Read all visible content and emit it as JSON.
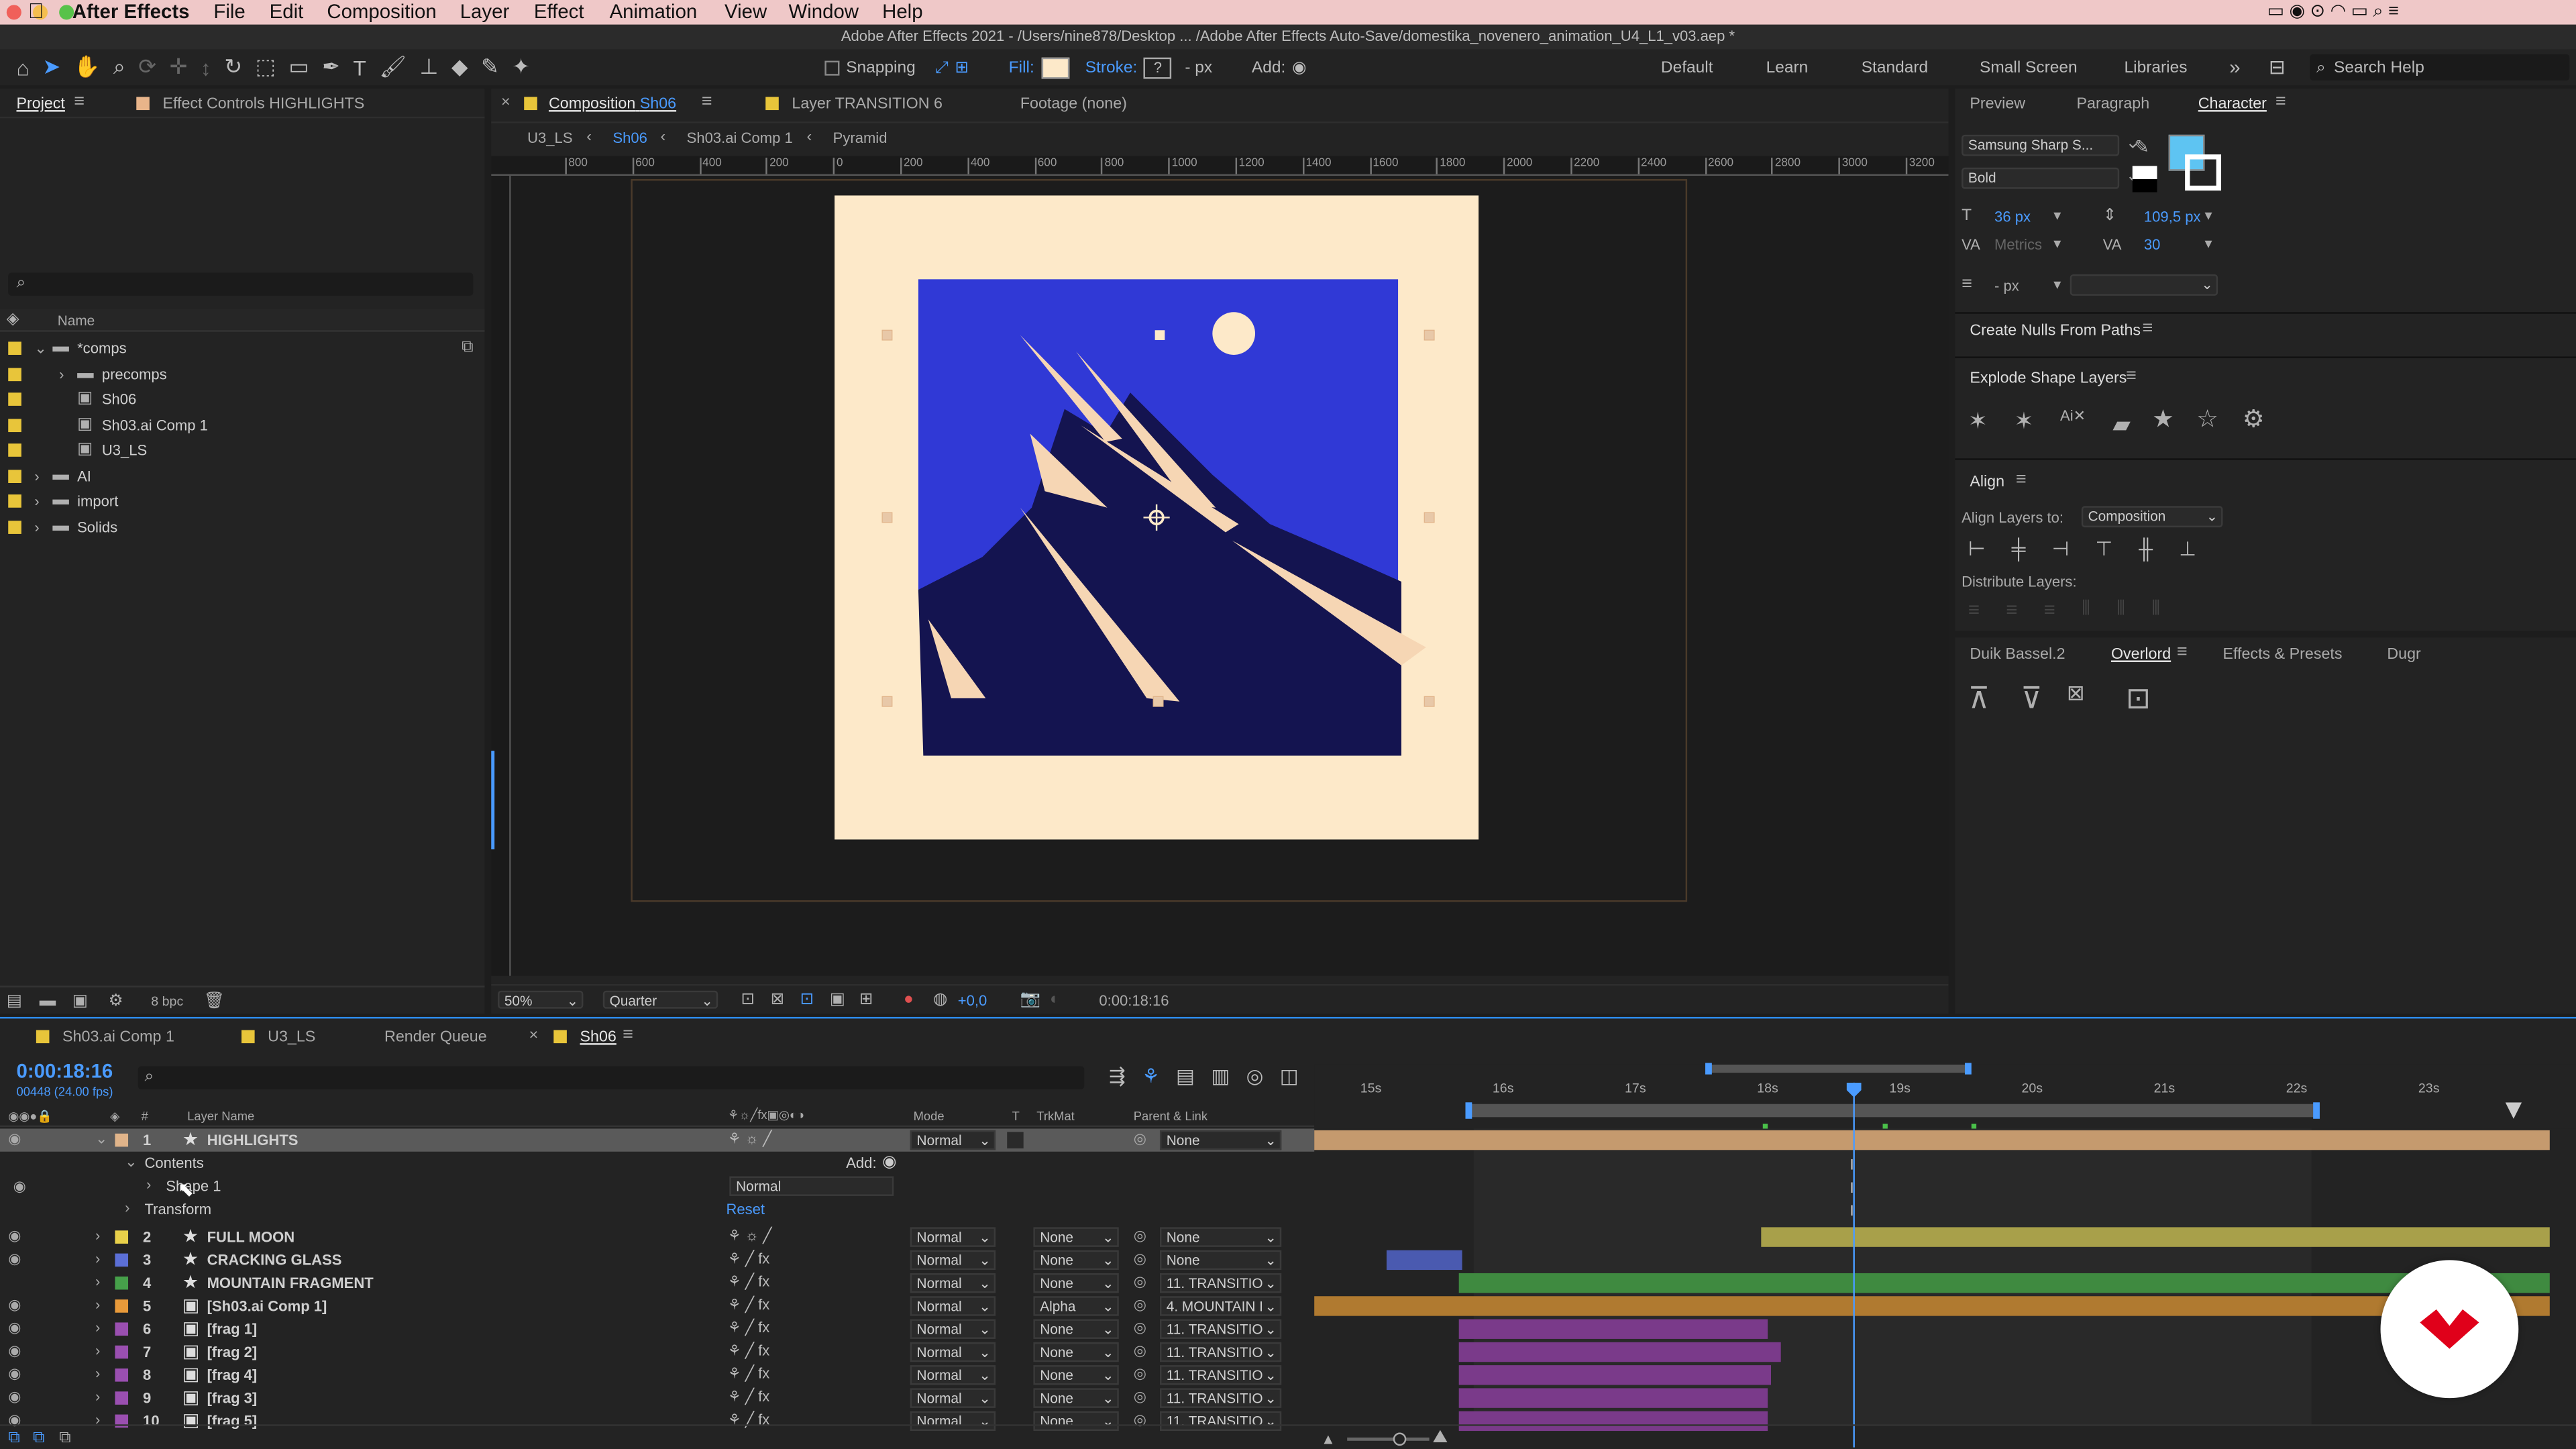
{
  "menubar": {
    "app": "After Effects",
    "items": [
      "File",
      "Edit",
      "Composition",
      "Layer",
      "Effect",
      "Animation",
      "View",
      "Window",
      "Help"
    ],
    "bg": "#efc8c8"
  },
  "title": "Adobe After Effects 2021 - /Users/nine878/Desktop ... /Adobe After Effects Auto-Save/domestika_novenero_animation_U4_L1_v03.aep *",
  "toolbar": {
    "snapping": "Snapping",
    "fill": "Fill:",
    "stroke": "Stroke:",
    "stroke_val": "?",
    "px": "- px",
    "add": "Add:",
    "workspaces": [
      "Default",
      "Learn",
      "Standard",
      "Small Screen",
      "Libraries"
    ],
    "search": "Search Help"
  },
  "project": {
    "tab": "Project",
    "effect_tab": "Effect Controls HIGHLIGHTS",
    "col_name": "Name",
    "items": [
      {
        "name": "*comps",
        "color": "#e8c53a",
        "indent": 0,
        "type": "folder",
        "open": true
      },
      {
        "name": "precomps",
        "color": "#e8c53a",
        "indent": 1,
        "type": "folder",
        "open": false
      },
      {
        "name": "Sh06",
        "color": "#e8c53a",
        "indent": 1,
        "type": "comp"
      },
      {
        "name": "Sh03.ai Comp 1",
        "color": "#e8c53a",
        "indent": 1,
        "type": "comp"
      },
      {
        "name": "U3_LS",
        "color": "#e8c53a",
        "indent": 1,
        "type": "comp"
      },
      {
        "name": "AI",
        "color": "#e8c53a",
        "indent": 0,
        "type": "folder",
        "open": false
      },
      {
        "name": "import",
        "color": "#e8c53a",
        "indent": 0,
        "type": "folder",
        "open": false
      },
      {
        "name": "Solids",
        "color": "#e8c53a",
        "indent": 0,
        "type": "folder",
        "open": false
      }
    ],
    "bpc": "8 bpc"
  },
  "viewer": {
    "tab_prefix": "Composition",
    "tab_name": "Sh06",
    "layer_tab": "Layer TRANSITION 6",
    "footage_tab": "Footage (none)",
    "breadcrumbs": [
      "U3_LS",
      "Sh06",
      "Sh03.ai Comp 1",
      "Pyramid"
    ],
    "ruler": [
      "800",
      "600",
      "400",
      "200",
      "0",
      "200",
      "400",
      "600",
      "800",
      "1000",
      "1200",
      "1400",
      "1600",
      "1800",
      "2000",
      "2200",
      "2400",
      "2600",
      "2800",
      "3000",
      "3200"
    ],
    "zoom": "50%",
    "quality": "Quarter",
    "exposure": "+0,0",
    "time": "0:00:18:16"
  },
  "right": {
    "tabs": [
      "Preview",
      "Paragraph",
      "Character"
    ],
    "font": "Samsung Sharp S...",
    "style": "Bold",
    "size": "36 px",
    "leading": "109,5 px",
    "kerning": "Metrics",
    "tracking": "30",
    "stroke_w": "- px",
    "nulls": "Create Nulls From Paths",
    "explode": "Explode Shape Layers",
    "align": "Align",
    "align_to_label": "Align Layers to:",
    "align_to": "Composition",
    "distribute": "Distribute Layers:",
    "tabs2": [
      "Duik Bassel.2",
      "Overlord",
      "Effects & Presets",
      "Dugr"
    ],
    "fill_color": "#5ec4f2"
  },
  "timeline": {
    "tabs": [
      "Sh03.ai Comp 1",
      "U3_LS",
      "Render Queue",
      "Sh06"
    ],
    "time": "0:00:18:16",
    "frames": "00448 (24.00 fps)",
    "headers": {
      "layer": "Layer Name",
      "mode": "Mode",
      "t": "T",
      "trk": "TrkMat",
      "parent": "Parent & Link"
    },
    "ruler": [
      "15s",
      "16s",
      "17s",
      "18s",
      "19s",
      "20s",
      "21s",
      "22s",
      "23s"
    ],
    "contents": "Contents",
    "add": "Add:",
    "shape1": "Shape 1",
    "shape_mode": "Normal",
    "transform": "Transform",
    "reset": "Reset",
    "layers": [
      {
        "n": "1",
        "name": "HIGHLIGHTS",
        "color": "#e0b48a",
        "mode": "Normal",
        "trk": "",
        "parent": "None",
        "bracket": false
      },
      {
        "n": "2",
        "name": "FULL MOON",
        "color": "#e8d04a",
        "mode": "Normal",
        "trk": "None",
        "parent": "None",
        "bracket": false
      },
      {
        "n": "3",
        "name": "CRACKING GLASS",
        "color": "#5b6fd6",
        "mode": "Normal",
        "trk": "None",
        "parent": "None",
        "bracket": false
      },
      {
        "n": "4",
        "name": "MOUNTAIN FRAGMENT",
        "color": "#46a04a",
        "mode": "Normal",
        "trk": "None",
        "parent": "11. TRANSITIO",
        "bracket": false
      },
      {
        "n": "5",
        "name": "[Sh03.ai Comp 1]",
        "color": "#e89a3a",
        "mode": "Normal",
        "trk": "Alpha",
        "parent": "4. MOUNTAIN I",
        "bracket": true
      },
      {
        "n": "6",
        "name": "[frag 1]",
        "color": "#9a4fb0",
        "mode": "Normal",
        "trk": "None",
        "parent": "11. TRANSITIO",
        "bracket": true
      },
      {
        "n": "7",
        "name": "[frag 2]",
        "color": "#9a4fb0",
        "mode": "Normal",
        "trk": "None",
        "parent": "11. TRANSITIO",
        "bracket": true
      },
      {
        "n": "8",
        "name": "[frag 4]",
        "color": "#9a4fb0",
        "mode": "Normal",
        "trk": "None",
        "parent": "11. TRANSITIO",
        "bracket": true
      },
      {
        "n": "9",
        "name": "[frag 3]",
        "color": "#9a4fb0",
        "mode": "Normal",
        "trk": "None",
        "parent": "11. TRANSITIO",
        "bracket": true
      },
      {
        "n": "10",
        "name": "[frag 5]",
        "color": "#9a4fb0",
        "mode": "Normal",
        "trk": "None",
        "parent": "11. TRANSITIO",
        "bracket": true
      }
    ]
  },
  "colors": {
    "accent": "#2d8cf0",
    "comp_bg": "#fde9c9",
    "sky": "#3039d6",
    "mountain": "#141450",
    "highlight": "#f6d6b4"
  }
}
